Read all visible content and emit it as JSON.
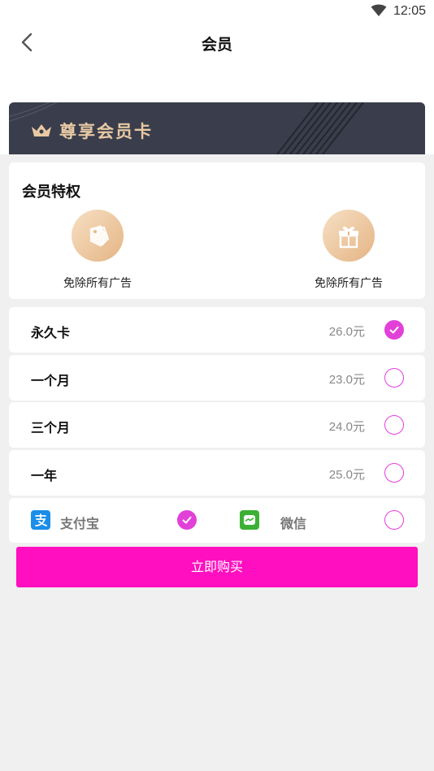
{
  "status": {
    "time": "12:05"
  },
  "nav": {
    "title": "会员"
  },
  "banner": {
    "title": "尊享会员卡"
  },
  "privileges": {
    "title": "会员特权",
    "items": [
      {
        "icon": "price-tag-icon",
        "label": "免除所有广告"
      },
      {
        "icon": "gift-icon",
        "label": "免除所有广告"
      }
    ]
  },
  "plans": [
    {
      "name": "永久卡",
      "price": "26.0元",
      "selected": true
    },
    {
      "name": "一个月",
      "price": "23.0元",
      "selected": false
    },
    {
      "name": "三个月",
      "price": "24.0元",
      "selected": false
    },
    {
      "name": "一年",
      "price": "25.0元",
      "selected": false
    }
  ],
  "payment": {
    "alipay": {
      "label": "支付宝",
      "selected": true
    },
    "wechat": {
      "label": "微信",
      "selected": false
    }
  },
  "buy_button": {
    "label": "立即购买"
  },
  "colors": {
    "accent": "#ff0fbf",
    "check": "#e241d8",
    "banner_bg": "#3a3d4b",
    "gold": "#e8c9a4"
  }
}
